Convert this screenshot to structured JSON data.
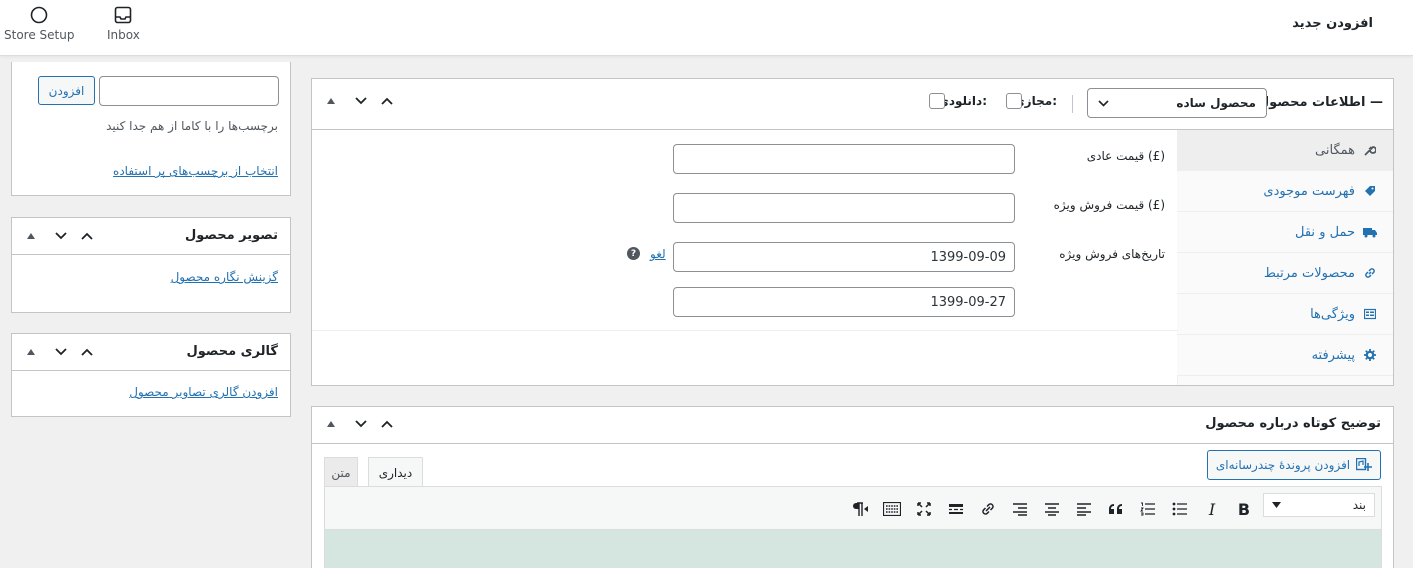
{
  "topbar": {
    "store_setup": "Store Setup",
    "inbox": "Inbox",
    "page_title": "افزودن جدید"
  },
  "tags_box": {
    "add_button": "افزودن",
    "hint": "برچسب‌ها را با کاما از هم جدا کنید",
    "choose_link": "انتخاب از برچسب‌های پر استفاده"
  },
  "product_image": {
    "title": "تصویر محصول",
    "link": "گزینش نگاره محصول"
  },
  "product_gallery": {
    "title": "گالری محصول",
    "link": "افزودن گالری تصاویر محصول"
  },
  "product_data": {
    "title": "اطلاعات محصول —",
    "type_selected": "محصول ساده",
    "virtual_label": "مجازی:",
    "downloadable_label": "دانلودی:",
    "tabs": [
      {
        "label": "همگانی",
        "icon": "wrench-icon"
      },
      {
        "label": "فهرست موجودی",
        "icon": "tag-icon"
      },
      {
        "label": "حمل و نقل",
        "icon": "truck-icon"
      },
      {
        "label": "محصولات مرتبط",
        "icon": "link-icon"
      },
      {
        "label": "ویژگی‌ها",
        "icon": "table-icon"
      },
      {
        "label": "پیشرفته",
        "icon": "gear-icon"
      }
    ],
    "regular_price_label": "قیمت عادی (£)",
    "sale_price_label": "قیمت فروش ویژه (£)",
    "sale_dates_label": "تاریخ‌های فروش ویژه",
    "cancel_link": "لغو",
    "date_from": "1399-09-09",
    "date_to": "1399-09-27",
    "regular_price": "",
    "sale_price": ""
  },
  "short_desc": {
    "title": "توضیح کوتاه درباره محصول",
    "add_media": "افزودن پروندهٔ چندرسانه‌ای",
    "tab_visual": "دیداری",
    "tab_text": "متن",
    "format_selected": "بند"
  },
  "colors": {
    "accent": "#2271b1",
    "editor_bg": "#d5e6e0"
  }
}
